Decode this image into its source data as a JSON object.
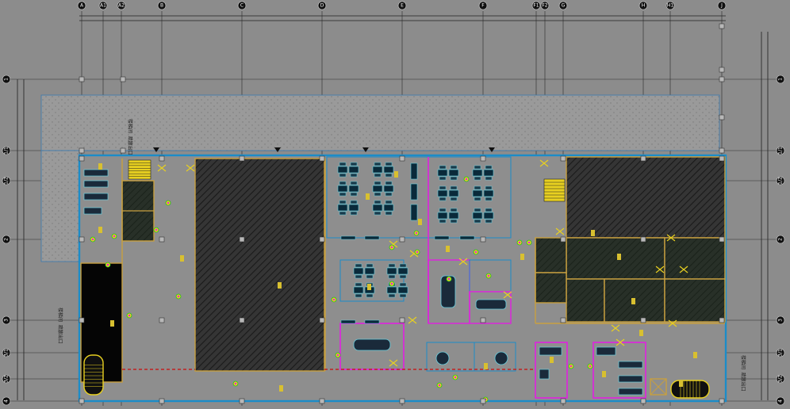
{
  "drawing": {
    "colors": {
      "background": "#8c8c8c",
      "grid_line": "#2a2a2a",
      "exterior_wall": "#1c8cc8",
      "interior_wall": "#c8a040",
      "partition": "#e020e0",
      "furniture": "#0a2a3a",
      "hatch_dark": "#262626",
      "column": "#b8b8b8"
    },
    "column_grid_labels": [
      "A",
      "A1",
      "A2",
      "B",
      "C",
      "D",
      "E",
      "F",
      "F1",
      "F2",
      "G",
      "H",
      "H1",
      "J"
    ],
    "row_grid_labels": [
      "1",
      "1/1",
      "1/2",
      "2",
      "3",
      "3/1",
      "3/2",
      "4"
    ],
    "side_notes": {
      "stair_note_upper": "楼梯间 疏散出口",
      "stair_note_left": "楼梯间 疏散出口",
      "stair_note_right": "楼梯间 疏散出口"
    },
    "icons": [
      "north-marker-icon",
      "door-swing-icon",
      "stair-icon",
      "column-icon"
    ]
  }
}
